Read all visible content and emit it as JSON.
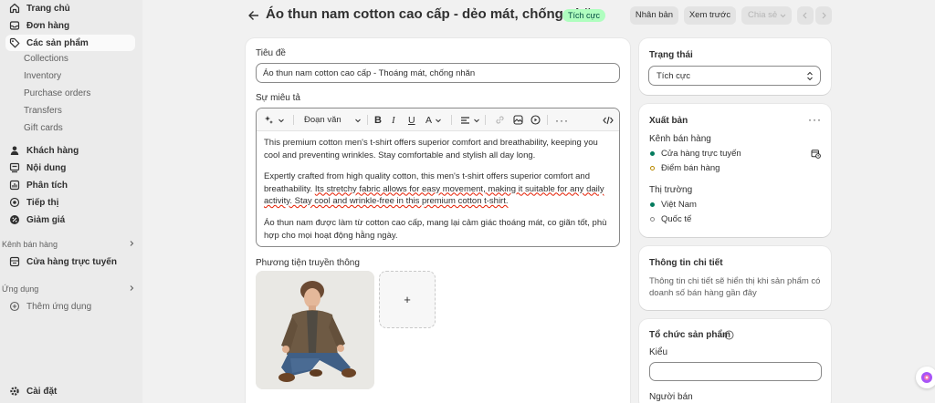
{
  "sidebar": {
    "main_items": [
      {
        "label": "Trang chủ"
      },
      {
        "label": "Đơn hàng"
      },
      {
        "label": "Các sản phẩm"
      }
    ],
    "product_sub": [
      "Collections",
      "Inventory",
      "Purchase orders",
      "Transfers",
      "Gift cards"
    ],
    "more_items": [
      {
        "label": "Khách hàng"
      },
      {
        "label": "Nội dung"
      },
      {
        "label": "Phân tích"
      },
      {
        "label": "Tiếp thị"
      },
      {
        "label": "Giảm giá"
      }
    ],
    "sales_channels_heading": "Kênh bán hàng",
    "online_store": "Cửa hàng trực tuyến",
    "apps_heading": "Ứng dụng",
    "add_app": "Thêm ứng dụng",
    "settings": "Cài đặt"
  },
  "header": {
    "title": "Áo thun nam cotton cao cấp - dẻo mát, chống nhăn",
    "status_badge": "Tích cực",
    "duplicate_label": "Nhân bản",
    "preview_label": "Xem trước",
    "share_label": "Chia sẻ"
  },
  "form": {
    "title_label": "Tiêu đề",
    "title_value": "Áo thun nam cotton cao cấp - Thoáng mát, chống nhăn",
    "description_label": "Sự miêu tả",
    "paragraph_style": "Đoạn văn",
    "desc_p1": "This premium cotton men's t-shirt offers superior comfort and breathability, keeping you cool and preventing wrinkles. Stay comfortable and stylish all day long.",
    "desc_p2_a": "Expertly crafted from high quality cotton, this men's t-shirt offers superior comfort and breathability. ",
    "desc_p2_b": "Its stretchy fabric allows for easy movement, making it suitable for any daily activity. Stay cool and wrinkle-free in this premium cotton t-shirt.",
    "desc_p3": "Áo thun nam được làm từ cotton cao cấp, mang lại cảm giác thoáng mát, co giãn tốt, phù hợp cho mọi hoạt động hằng ngày.",
    "media_label": "Phương tiện truyền thông",
    "add_media": "+"
  },
  "status_card": {
    "label": "Trạng thái",
    "value": "Tích cực"
  },
  "publishing": {
    "label": "Xuất bản",
    "channels_label": "Kênh bán hàng",
    "channels": [
      {
        "name": "Cửa hàng trực tuyến",
        "active": true
      },
      {
        "name": "Điểm bán hàng",
        "active": false
      }
    ],
    "markets_label": "Thị trường",
    "markets": [
      {
        "name": "Việt Nam",
        "active": true
      },
      {
        "name": "Quốc tế",
        "active": false
      }
    ]
  },
  "insights": {
    "label": "Thông tin chi tiết",
    "text": "Thông tin chi tiết sẽ hiển thị khi sản phẩm có doanh số bán hàng gần đây"
  },
  "organization": {
    "label": "Tổ chức sản phẩm",
    "type_label": "Kiểu",
    "type_value": "",
    "vendor_label": "Người bán"
  },
  "colors": {
    "accent_green": "#047b5d",
    "badge_bg": "#affebf",
    "sidebar_bg": "#ebebeb"
  }
}
